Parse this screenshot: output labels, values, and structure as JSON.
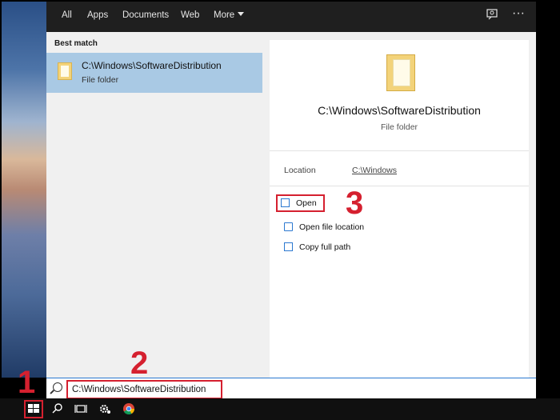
{
  "search_panel": {
    "tabs": [
      "All",
      "Apps",
      "Documents",
      "Web",
      "More"
    ],
    "best_match_label": "Best match",
    "result": {
      "title": "C:\\Windows\\SoftwareDistribution",
      "subtitle": "File folder"
    },
    "detail": {
      "title": "C:\\Windows\\SoftwareDistribution",
      "subtitle": "File folder",
      "location_label": "Location",
      "location_value": "C:\\Windows",
      "actions": [
        "Open",
        "Open file location",
        "Copy full path"
      ]
    }
  },
  "search_box": {
    "value": "C:\\Windows\\SoftwareDistribution"
  },
  "annotations": {
    "step1": "1",
    "step2": "2",
    "step3": "3",
    "color": "#d5202f"
  },
  "icons": {
    "feedback": "feedback-icon",
    "more_options": "ellipsis-icon",
    "folder": "folder-icon",
    "search": "search-icon",
    "start": "windows-start-icon",
    "task_view": "task-view-icon",
    "settings": "settings-gear-icon",
    "chrome": "chrome-icon"
  }
}
